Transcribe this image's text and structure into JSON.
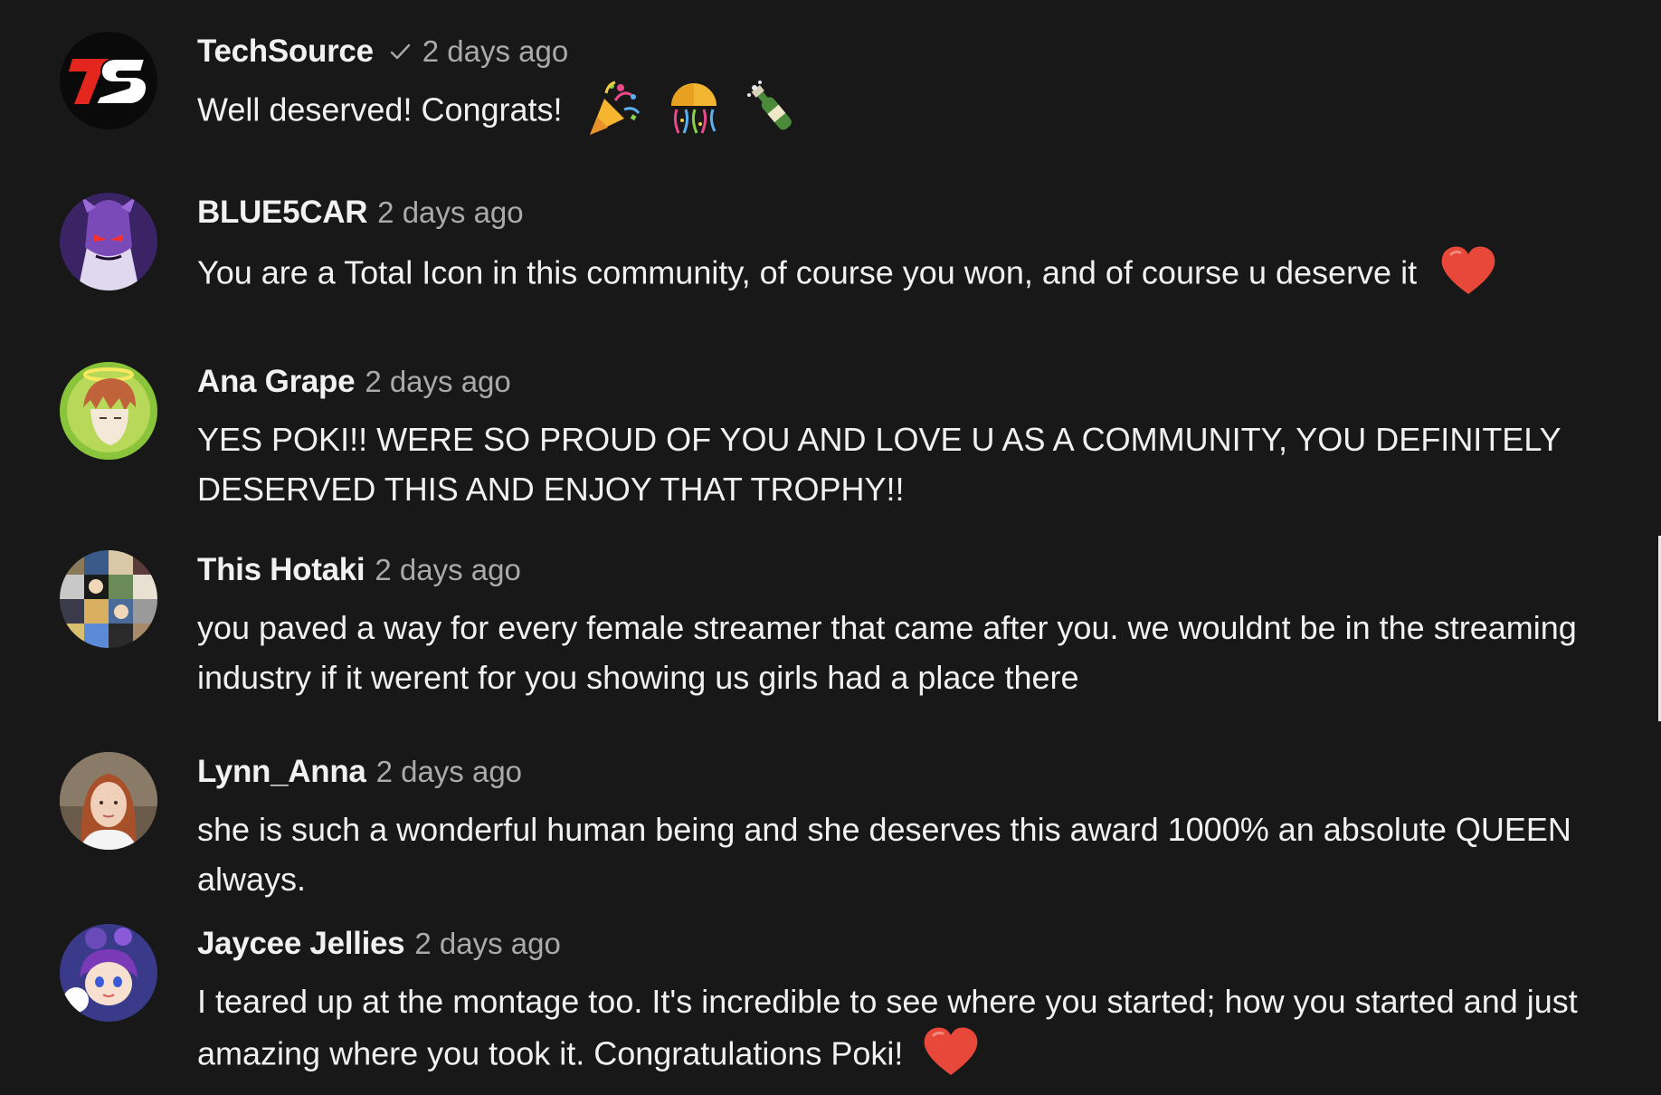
{
  "comments": [
    {
      "author": "TechSource",
      "verified": true,
      "time": "2 days ago",
      "text": "Well deserved! Congrats!",
      "emojis": [
        "party-popper",
        "confetti-ball",
        "champagne-bottle"
      ],
      "avatar_icon": "techsource-logo",
      "avatar_text": "TS"
    },
    {
      "author": "BLUE5CAR",
      "verified": false,
      "time": "2 days ago",
      "text": "You are a Total Icon in this community, of course you won, and of course u deserve it",
      "emojis": [
        "red-heart"
      ],
      "avatar_icon": "purple-character-avatar"
    },
    {
      "author": "Ana Grape",
      "verified": false,
      "time": "2 days ago",
      "text": "YES POKI!! WERE SO PROUD OF YOU AND LOVE U AS A COMMUNITY, YOU DEFINITELY DESERVED THIS AND ENJOY THAT TROPHY!!",
      "emojis": [],
      "avatar_icon": "anime-angel-avatar"
    },
    {
      "author": "This Hotaki",
      "verified": false,
      "time": "2 days ago",
      "text": "you paved a way for every female streamer that came after you. we wouldnt be in the streaming industry if it werent for you showing us girls had a place there",
      "emojis": [],
      "avatar_icon": "collage-avatar"
    },
    {
      "author": "Lynn_Anna",
      "verified": false,
      "time": "2 days ago",
      "text": "she is such a wonderful human being and she deserves this award 1000% an absolute QUEEN always.",
      "emojis": [],
      "avatar_icon": "photo-avatar"
    },
    {
      "author": "Jaycee Jellies",
      "verified": false,
      "time": "2 days ago",
      "text": "I teared up at the montage too. It's incredible to see where you started; how you started and just amazing where you took it. Congratulations Poki!",
      "emojis": [
        "red-heart"
      ],
      "avatar_icon": "cartoon-girl-avatar"
    }
  ],
  "colors": {
    "background": "#181818",
    "text": "#f1f1f1",
    "secondary_text": "#aaaaaa",
    "heart": "#e8483a",
    "techsource_red": "#e4261f"
  }
}
